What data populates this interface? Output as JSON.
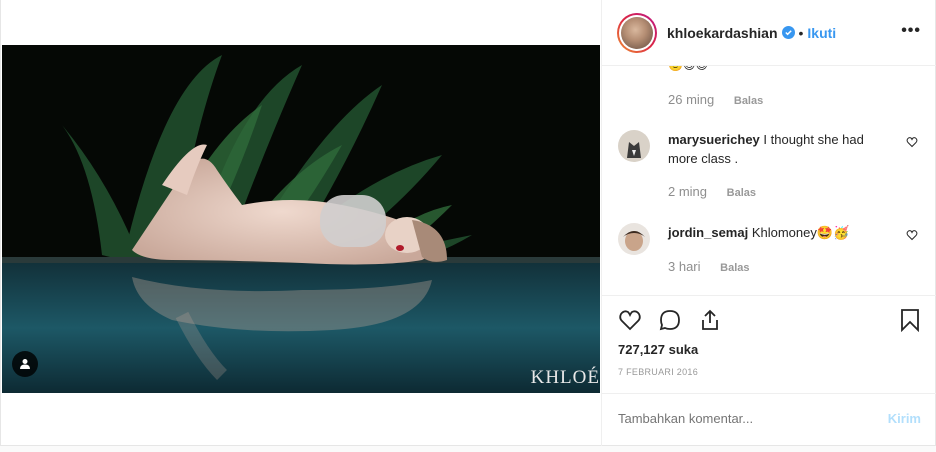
{
  "post": {
    "username": "khloekardashian",
    "separator": "•",
    "follow_label": "Ikuti",
    "more_label": "•••",
    "watermark": "KHLOÉ",
    "top_comment_emojis": "🙂😉😊",
    "top_comment_time": "26 ming",
    "top_comment_reply": "Balas",
    "comments": [
      {
        "username": "marysuerichey",
        "text": "I thought she had more class .",
        "time": "2 ming",
        "reply": "Balas"
      },
      {
        "username": "jordin_semaj",
        "text": "Khlomoney🤩🥳",
        "time": "3 hari",
        "reply": "Balas"
      }
    ],
    "likes": "727,127 suka",
    "date": "7 FEBRUARI 2016",
    "comment_placeholder": "Tambahkan komentar...",
    "post_label": "Kirim"
  },
  "colors": {
    "link_blue": "#3897f0",
    "post_disabled": "#b2dffc",
    "muted": "#8e8e8e"
  },
  "icons": [
    "user-tag-icon",
    "verified-badge-icon",
    "heart-icon",
    "comment-icon",
    "share-icon",
    "bookmark-icon",
    "more-icon"
  ]
}
